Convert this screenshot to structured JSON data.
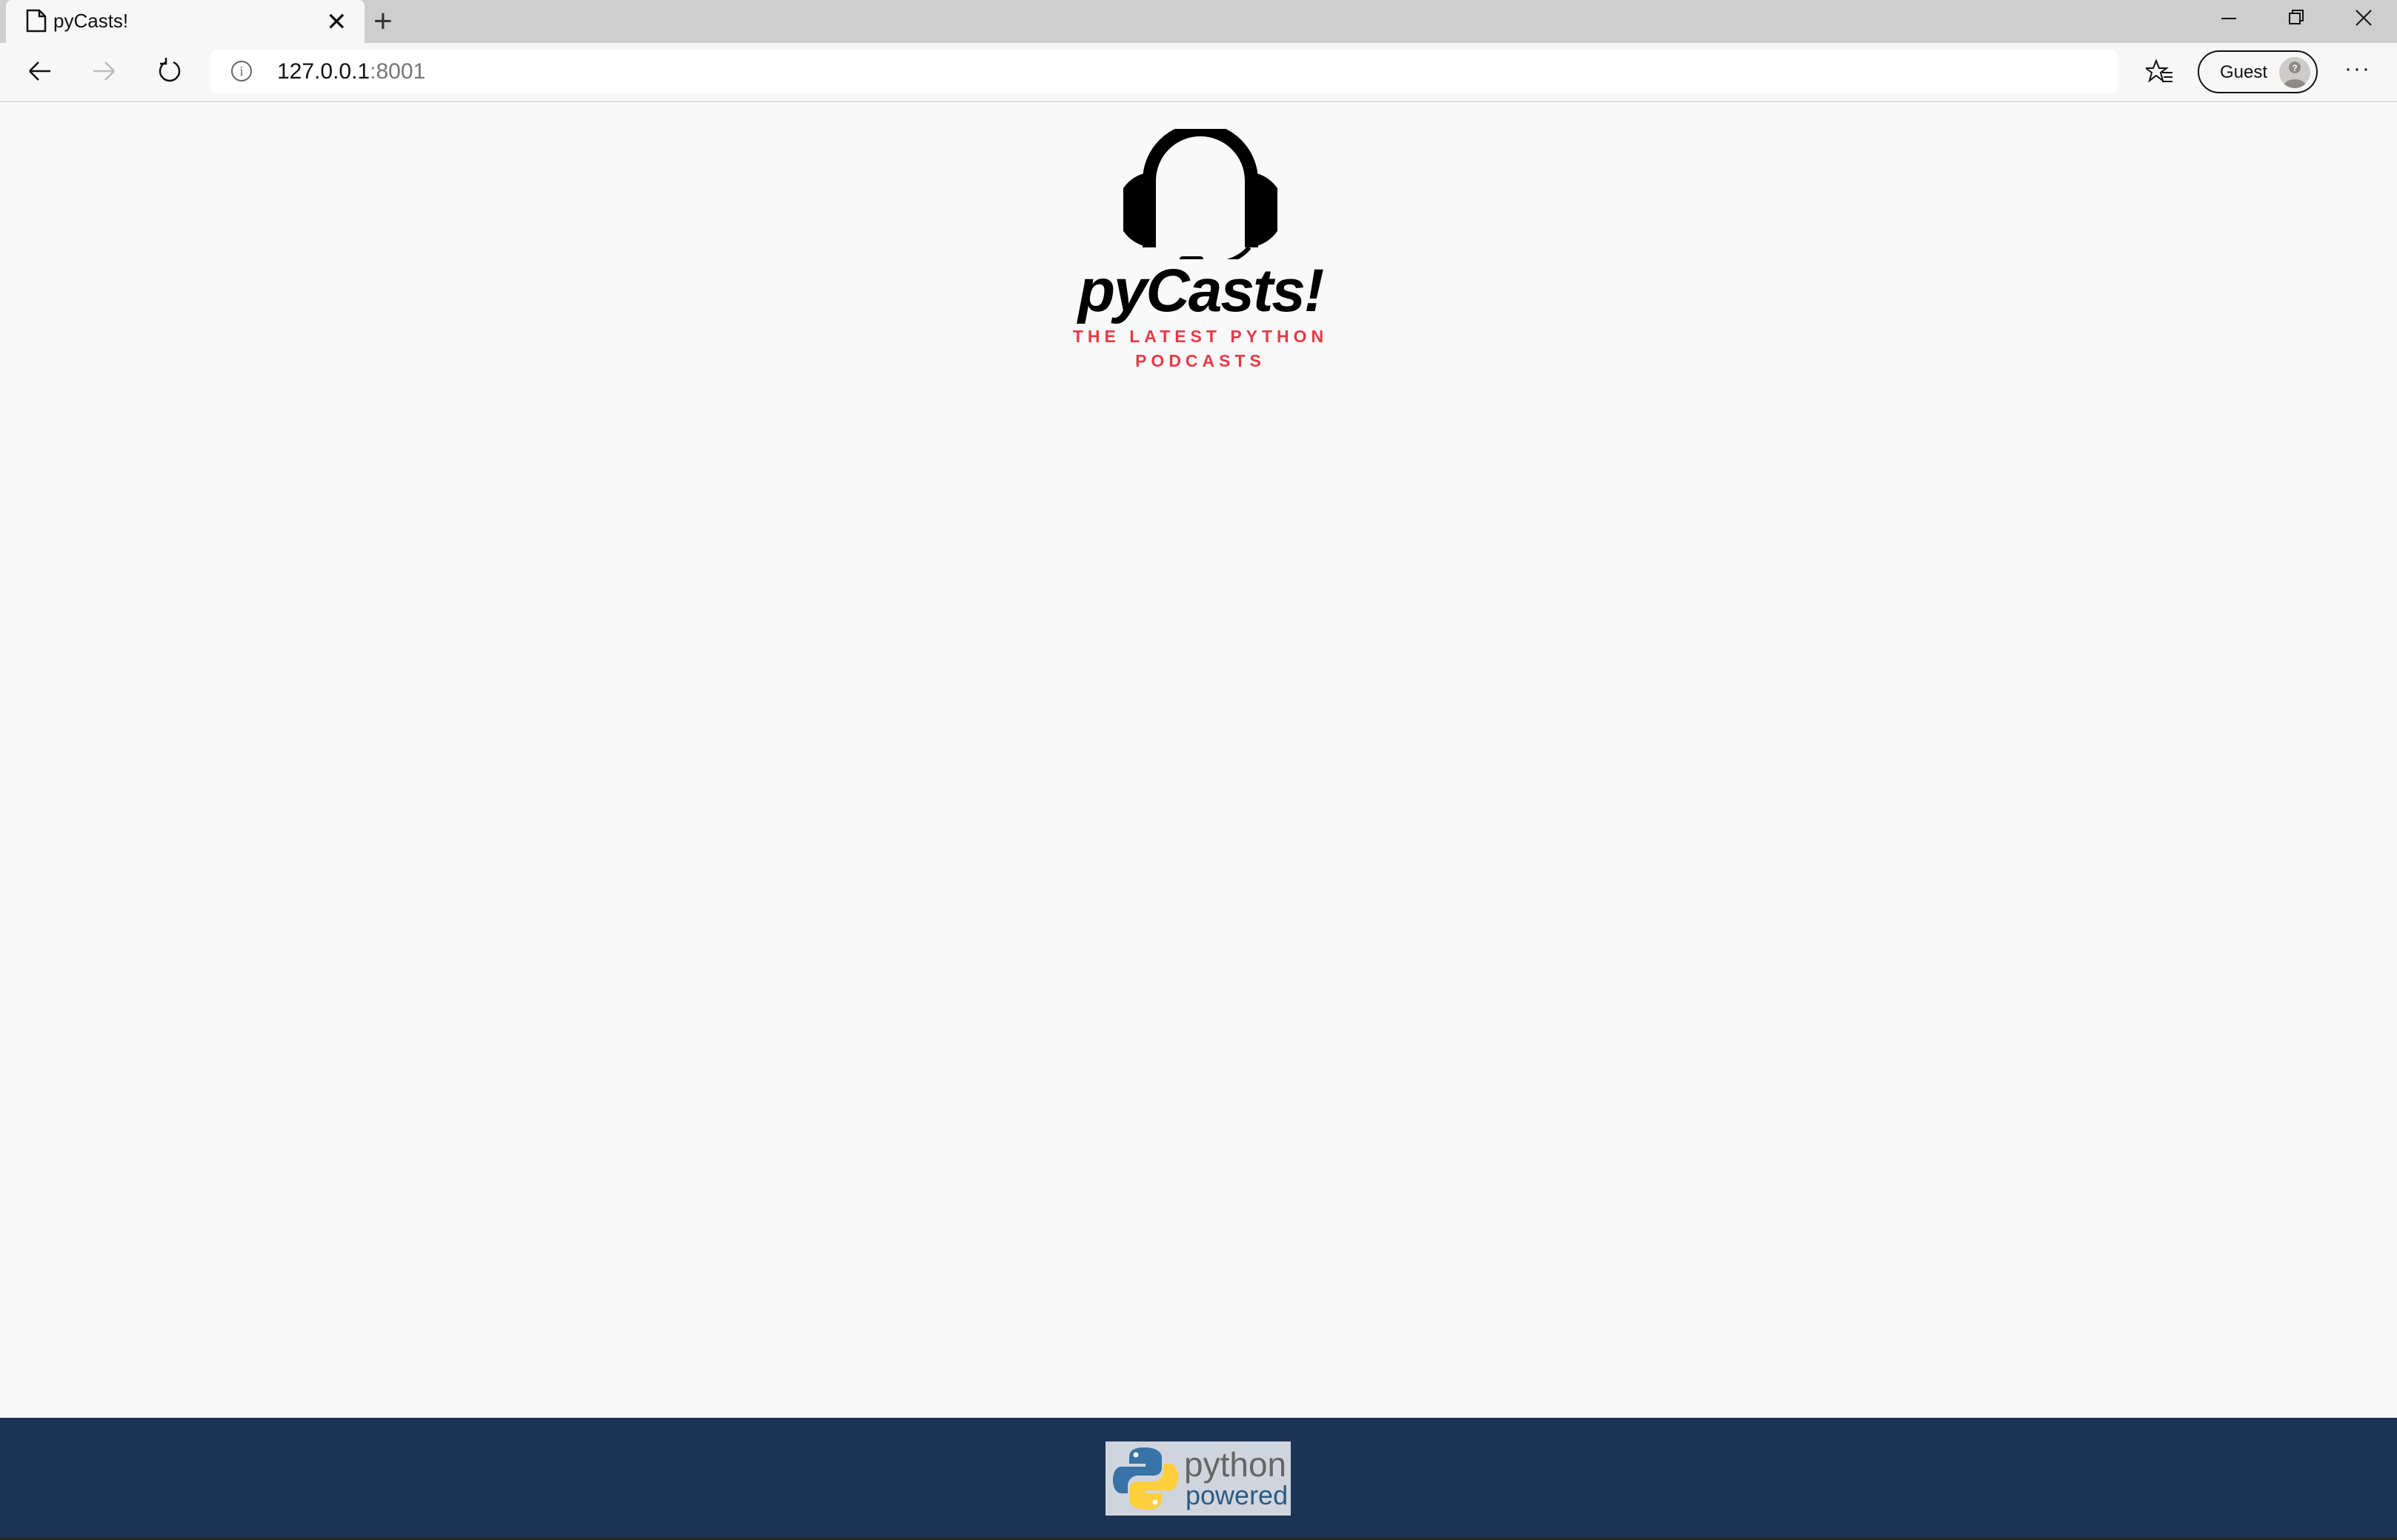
{
  "browser": {
    "tab_title": "pyCasts!",
    "url_host": "127.0.0.1",
    "url_port": ":8001",
    "profile_label": "Guest"
  },
  "page": {
    "brand": "pyCasts!",
    "tagline": "THE LATEST PYTHON PODCASTS",
    "footer_badge": {
      "line1": "python",
      "line2": "powered"
    }
  },
  "colors": {
    "accent": "#e63946",
    "footer_bg": "#1c3455",
    "page_bg": "#f9f9f9"
  },
  "icons": [
    "document-icon",
    "close-icon",
    "plus-icon",
    "minimize-icon",
    "restore-icon",
    "window-close-icon",
    "back-arrow-icon",
    "forward-arrow-icon",
    "refresh-icon",
    "info-icon",
    "favorites-icon",
    "avatar-icon",
    "more-icon",
    "headphones-icon",
    "python-logo-icon"
  ]
}
